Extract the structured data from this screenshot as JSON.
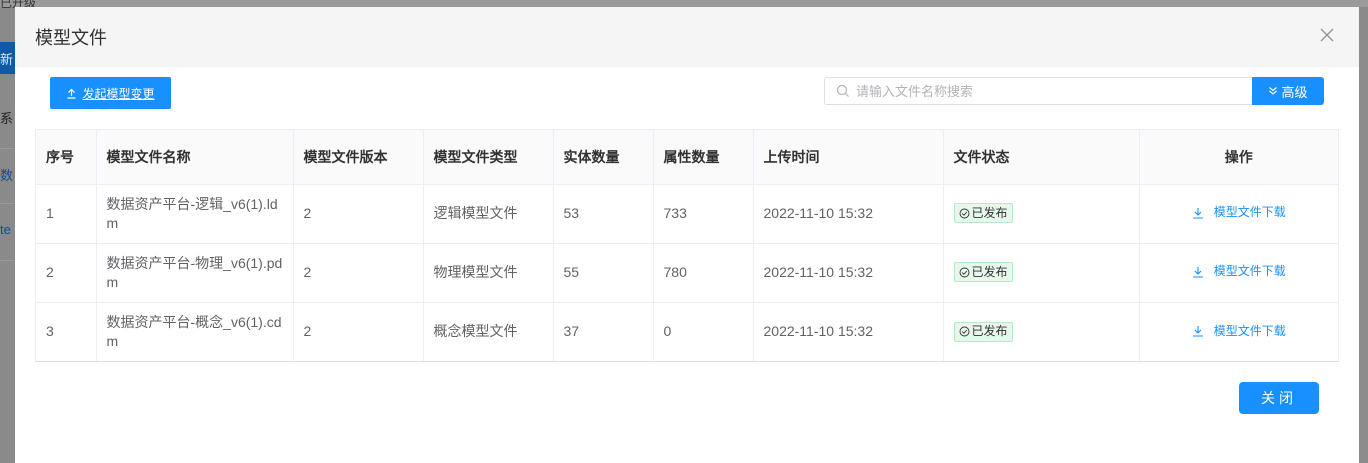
{
  "background": {
    "top_text": "已升级",
    "blue_tab": "新",
    "side_1": "系",
    "side_2": "数",
    "side_3": "te"
  },
  "dialog": {
    "title": "模型文件",
    "upload_button": "发起模型变更",
    "search_placeholder": "请输入文件名称搜索",
    "advanced_button": "高级",
    "close_button": "关闭"
  },
  "table": {
    "columns": [
      "序号",
      "模型文件名称",
      "模型文件版本",
      "模型文件类型",
      "实体数量",
      "属性数量",
      "上传时间",
      "文件状态",
      "操作"
    ],
    "rows": [
      {
        "index": "1",
        "name": "数据资产平台-逻辑_v6(1).ldm",
        "version": "2",
        "type": "逻辑模型文件",
        "entities": "53",
        "attributes": "733",
        "uploaded": "2022-11-10 15:32",
        "status": "已发布",
        "action": "模型文件下载"
      },
      {
        "index": "2",
        "name": "数据资产平台-物理_v6(1).pdm",
        "version": "2",
        "type": "物理模型文件",
        "entities": "55",
        "attributes": "780",
        "uploaded": "2022-11-10 15:32",
        "status": "已发布",
        "action": "模型文件下载"
      },
      {
        "index": "3",
        "name": "数据资产平台-概念_v6(1).cdm",
        "version": "2",
        "type": "概念模型文件",
        "entities": "37",
        "attributes": "0",
        "uploaded": "2022-11-10 15:32",
        "status": "已发布",
        "action": "模型文件下载"
      }
    ]
  },
  "colors": {
    "primary": "#1890ff",
    "status_bg": "#e6f7ec",
    "status_border": "#b7ebc8"
  },
  "icons": [
    "close-icon",
    "upload-icon",
    "search-icon",
    "double-chevron-down-icon",
    "check-circle-icon",
    "download-icon"
  ]
}
